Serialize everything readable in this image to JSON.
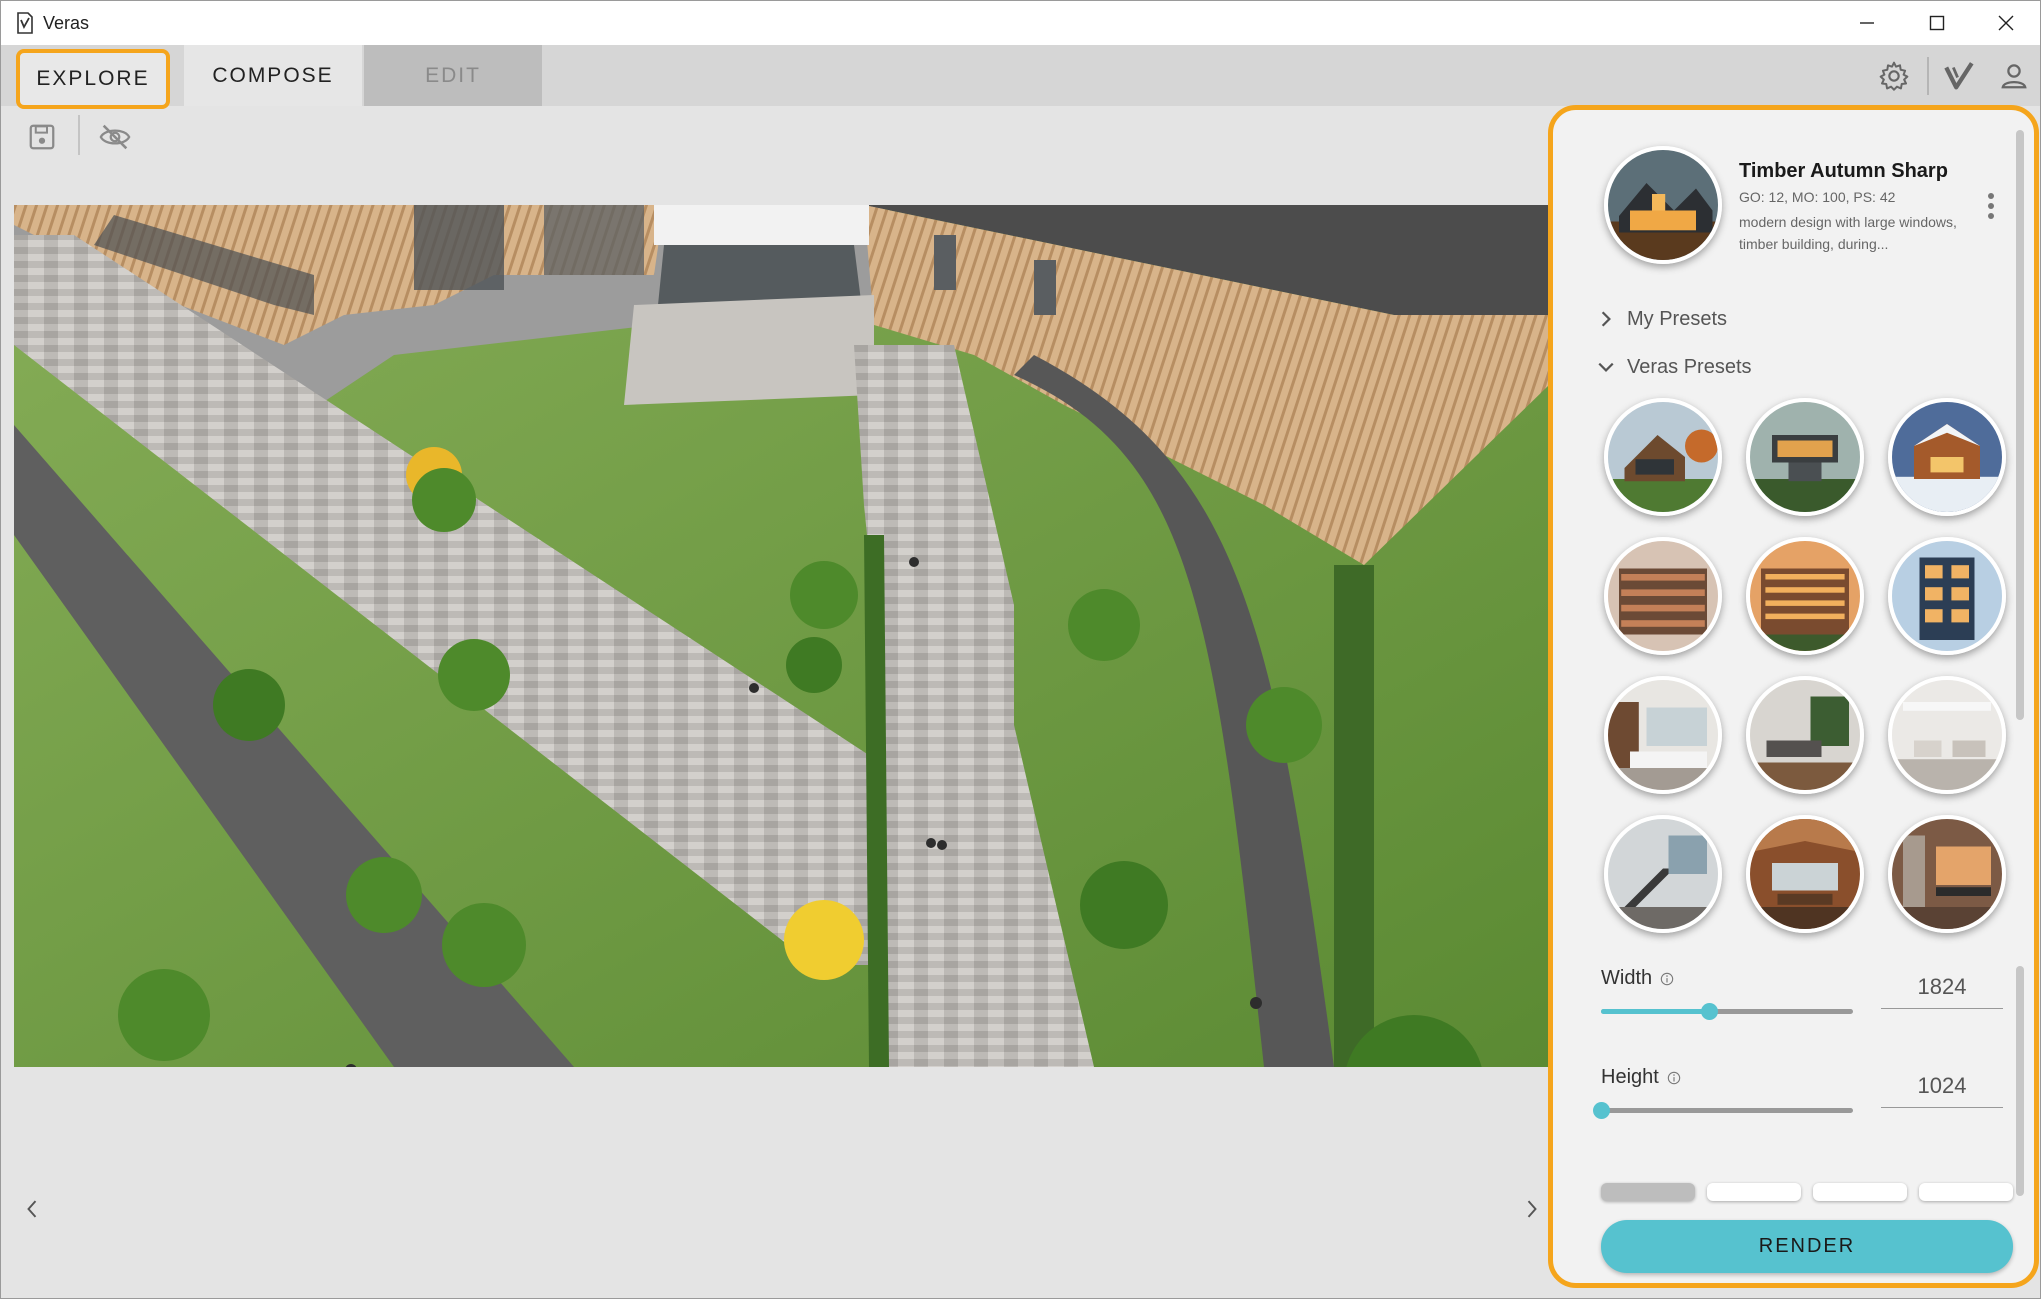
{
  "window": {
    "title": "Veras",
    "app_icon": "veras-icon",
    "controls": [
      "minimize-icon",
      "maximize-icon",
      "close-icon"
    ]
  },
  "tabs": {
    "explore": "EXPLORE",
    "compose": "COMPOSE",
    "edit": "EDIT",
    "active": "explore"
  },
  "toolbar_icons": [
    "gear-icon",
    "veras-check-icon",
    "user-icon"
  ],
  "subtoolbar_icons": [
    "save-icon",
    "eye-off-icon"
  ],
  "nav": {
    "prev": "chevron-left-icon",
    "next": "chevron-right-icon"
  },
  "panel": {
    "current_preset": {
      "name": "Timber Autumn Sharp",
      "params": "GO: 12, MO: 100, PS: 42",
      "description": "modern design with large windows, timber building, during..."
    },
    "sections": {
      "my_presets": "My Presets",
      "veras_presets": "Veras Presets"
    },
    "width": {
      "label": "Width",
      "value": "1824",
      "fraction": 0.43
    },
    "height": {
      "label": "Height",
      "value": "1024",
      "fraction": 0.0
    },
    "render_count_segments": 4,
    "render_count_selected": 1,
    "render_label": "RENDER",
    "accent_color": "#56c2cf",
    "highlight_color": "#f5a51c"
  }
}
